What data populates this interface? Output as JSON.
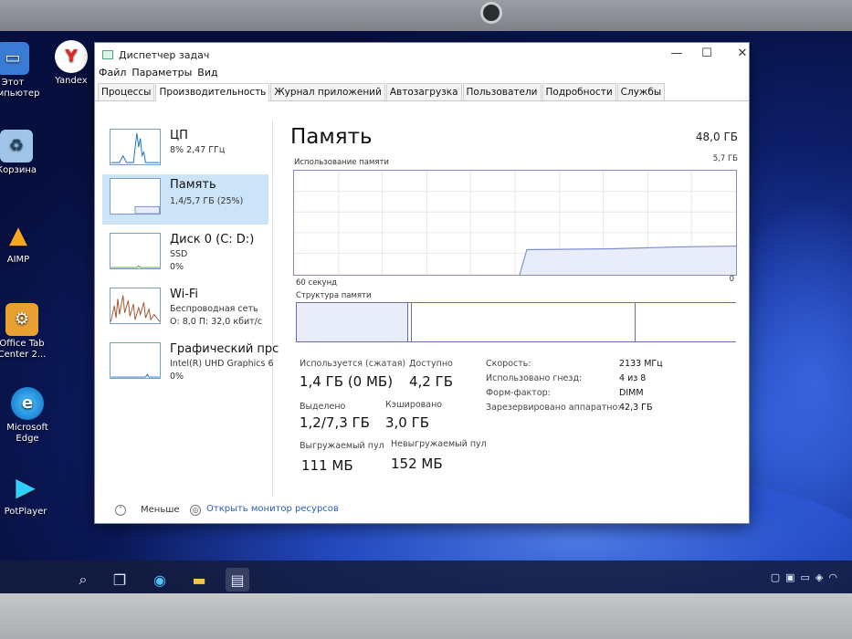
{
  "window": {
    "title": "Диспетчер задач",
    "controls": {
      "minimize": "—",
      "maximize": "☐",
      "close": "✕"
    }
  },
  "menu": [
    "Файл",
    "Параметры",
    "Вид"
  ],
  "tabs": [
    "Процессы",
    "Производительность",
    "Журнал приложений",
    "Автозагрузка",
    "Пользователи",
    "Подробности",
    "Службы"
  ],
  "sidebar": {
    "items": [
      {
        "title": "ЦП",
        "line1": "8% 2,47 ГГц",
        "line2": ""
      },
      {
        "title": "Память",
        "line1": "1,4/5,7 ГБ (25%)",
        "line2": ""
      },
      {
        "title": "Диск 0 (C: D:)",
        "line1": "SSD",
        "line2": "0%"
      },
      {
        "title": "Wi-Fi",
        "line1": "Беспроводная сеть",
        "line2": "О: 8,0 П: 32,0 кбит/с"
      },
      {
        "title": "Графический прс",
        "line1": "Intel(R) UHD Graphics 6",
        "line2": "0%"
      }
    ]
  },
  "main": {
    "title": "Память",
    "total": "48,0 ГБ",
    "usage_label": "Использование памяти",
    "usage_max": "5,7 ГБ",
    "time_left": "60 секунд",
    "time_right": "0",
    "structure_label": "Структура памяти",
    "stats": {
      "in_use_label": "Используется (сжатая)",
      "in_use_value": "1,4 ГБ (0 МБ)",
      "available_label": "Доступно",
      "available_value": "4,2 ГБ",
      "committed_label": "Выделено",
      "committed_value": "1,2/7,3 ГБ",
      "cached_label": "Кэшировано",
      "cached_value": "3,0 ГБ",
      "paged_label": "Выгружаемый пул",
      "paged_value": "111 МБ",
      "nonpaged_label": "Невыгружаемый пул",
      "nonpaged_value": "152 МБ"
    },
    "right": [
      {
        "label": "Скорость:",
        "value": "2133 МГц"
      },
      {
        "label": "Использовано гнезд:",
        "value": "4 из 8"
      },
      {
        "label": "Форм-фактор:",
        "value": "DIMM"
      },
      {
        "label": "Зарезервировано аппаратно:",
        "value": "42,3 ГБ"
      }
    ]
  },
  "footer": {
    "less": "Меньше",
    "monitor": "Открыть монитор ресурсов"
  },
  "desktop": [
    {
      "label": "Этот\nкомпьютер",
      "icon": "computer-icon"
    },
    {
      "label": "Yandex",
      "icon": "yandex-icon"
    },
    {
      "label": "Корзина",
      "icon": "recycle-bin-icon"
    },
    {
      "label": "AIMP",
      "icon": "aimp-icon"
    },
    {
      "label": "Office Tab\nCenter 2...",
      "icon": "office-tab-icon"
    },
    {
      "label": "Microsoft\nEdge",
      "icon": "edge-icon"
    },
    {
      "label": "PotPlayer",
      "icon": "potplayer-icon"
    }
  ],
  "colors": {
    "accent": "#cce4f7",
    "graph_line": "#7b8fd6",
    "graph_fill": "#e9edf9"
  }
}
